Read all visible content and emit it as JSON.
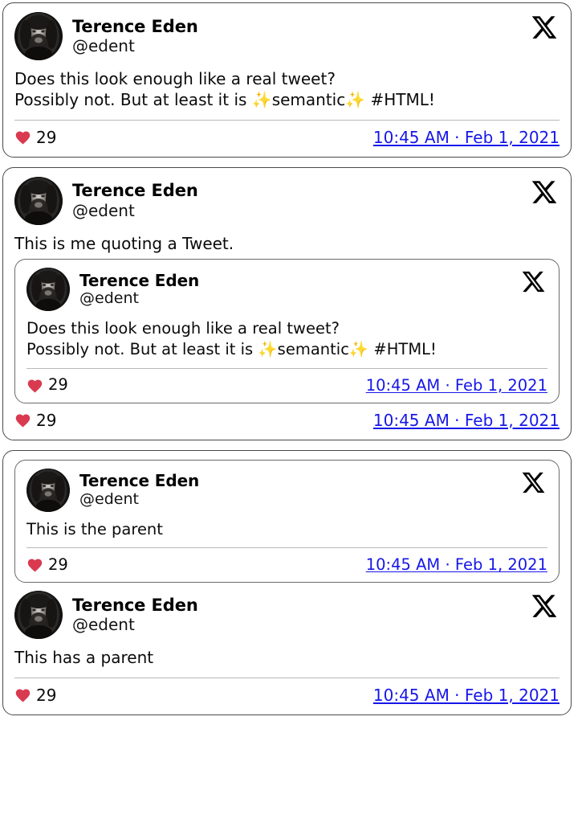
{
  "colors": {
    "link": "#1717e8",
    "heart": "#d93a50",
    "sparkle": "#f5a623",
    "card_border": "#4a4a4a",
    "divider": "#b9b9b9",
    "text": "#0b0b0b"
  },
  "account": {
    "display_name": "Terence Eden",
    "handle": "@edent",
    "avatar_alt": "Terence Eden profile photo",
    "brand_icon": "x-logo-icon"
  },
  "common": {
    "like_count": "29",
    "heart_icon": "heart-icon",
    "timestamp": "10:45 AM · Feb 1, 2021"
  },
  "cards": [
    {
      "id": "tweet-simple",
      "text": "Does this look enough like a real tweet?\nPossibly not. But at least it is ✨semantic✨ #HTML!",
      "text_parts": {
        "line1": "Does this look enough like a real tweet?",
        "line2_a": "Possibly not. But at least it is ",
        "sparkle1": "✨",
        "line2_b": "semantic",
        "sparkle2": "✨",
        "line2_c": " #HTML!"
      },
      "like_count": "29",
      "timestamp": "10:45 AM · Feb 1, 2021"
    },
    {
      "id": "tweet-quote",
      "text": "This is me quoting a Tweet.",
      "like_count": "29",
      "timestamp": "10:45 AM · Feb 1, 2021",
      "quoted": {
        "id": "quoted-tweet",
        "text_parts": {
          "line1": "Does this look enough like a real tweet?",
          "line2_a": "Possibly not. But at least it is ",
          "sparkle1": "✨",
          "line2_b": "semantic",
          "sparkle2": "✨",
          "line2_c": " #HTML!"
        },
        "like_count": "29",
        "timestamp": "10:45 AM · Feb 1, 2021"
      }
    },
    {
      "id": "tweet-thread",
      "parent": {
        "id": "parent-tweet",
        "text": "This is the parent",
        "like_count": "29",
        "timestamp": "10:45 AM · Feb 1, 2021"
      },
      "text": "This has a parent",
      "like_count": "29",
      "timestamp": "10:45 AM · Feb 1, 2021"
    }
  ]
}
